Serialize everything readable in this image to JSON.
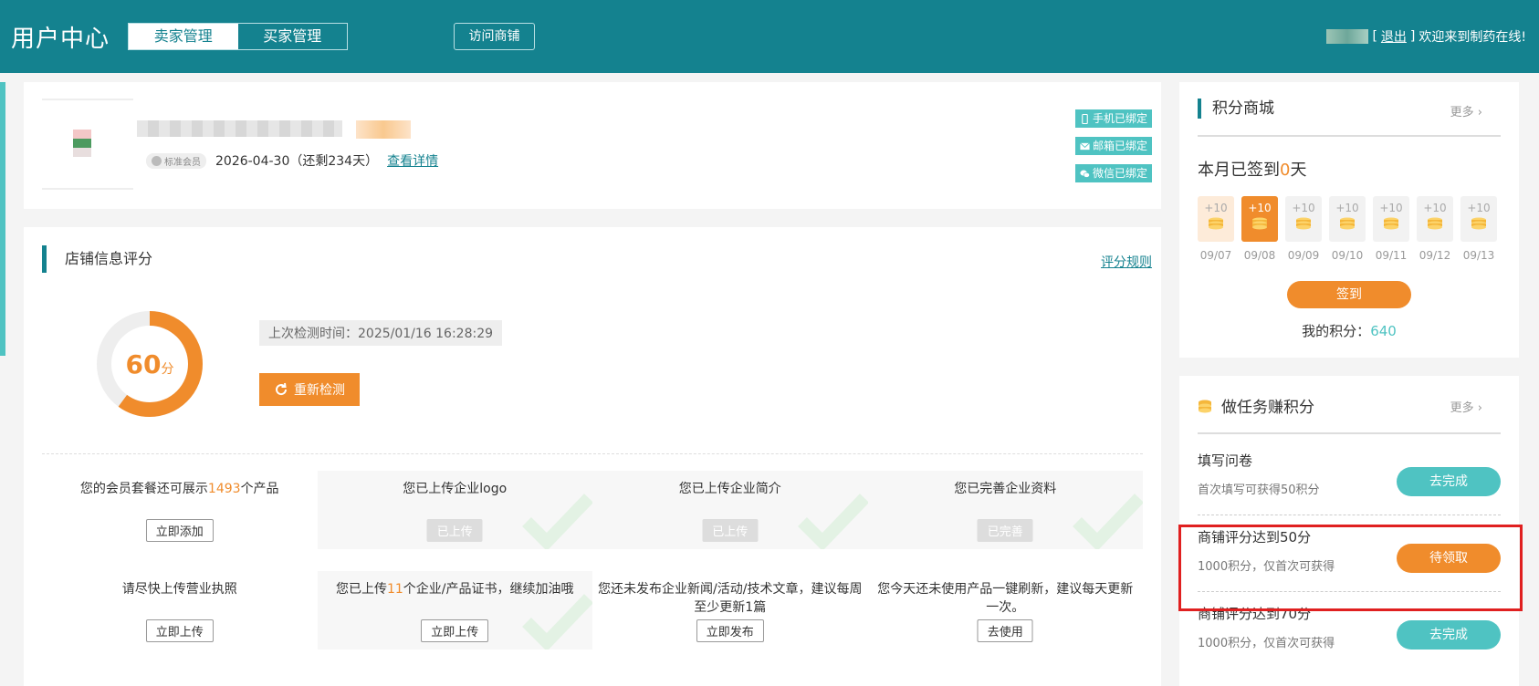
{
  "header": {
    "title": "用户中心",
    "tabs": [
      "卖家管理",
      "买家管理"
    ],
    "visit_shop": "访问商铺",
    "logout_open": "[",
    "logout": "退出",
    "logout_close": "]",
    "welcome": "欢迎来到制药在线!"
  },
  "profile": {
    "member_level": "标准会员",
    "expiry": "2026-04-30（还剩234天）",
    "detail_link": "查看详情",
    "bindings": [
      "手机已绑定",
      "邮箱已绑定",
      "微信已绑定"
    ]
  },
  "score": {
    "title": "店铺信息评分",
    "rules_link": "评分规则",
    "value": "60",
    "unit": "分",
    "percent": 60,
    "last_check": "上次检测时间：2025/01/16 16:28:29",
    "recheck": "重新检测",
    "cells": [
      {
        "pre": "您的会员套餐还可展示",
        "hl": "1493",
        "post": "个产品",
        "btn": "立即添加",
        "done": false
      },
      {
        "pre": "您已上传企业logo",
        "hl": "",
        "post": "",
        "btn": "已上传",
        "done": true
      },
      {
        "pre": "您已上传企业简介",
        "hl": "",
        "post": "",
        "btn": "已上传",
        "done": true
      },
      {
        "pre": "您已完善企业资料",
        "hl": "",
        "post": "",
        "btn": "已完善",
        "done": true
      },
      {
        "pre": "请尽快上传营业执照",
        "hl": "",
        "post": "",
        "btn": "立即上传",
        "done": false
      },
      {
        "pre": "您已上传",
        "hl": "11",
        "post": "个企业/产品证书，继续加油哦",
        "btn": "立即上传",
        "done": true
      },
      {
        "pre": "您还未发布企业新闻/活动/技术文章，建议每周至少更新1篇",
        "hl": "",
        "post": "",
        "btn": "立即发布",
        "done": false
      },
      {
        "pre": "您今天还未使用产品一键刷新，建议每天更新一次。",
        "hl": "",
        "post": "",
        "btn": "去使用",
        "done": false
      }
    ]
  },
  "mall": {
    "title": "积分商城",
    "more": "更多",
    "signed_pre": "本月已签到",
    "signed_count": "0",
    "signed_post": "天",
    "days": [
      {
        "bonus": "+10",
        "date": "09/07",
        "state": "first"
      },
      {
        "bonus": "+10",
        "date": "09/08",
        "state": "active"
      },
      {
        "bonus": "+10",
        "date": "09/09",
        "state": ""
      },
      {
        "bonus": "+10",
        "date": "09/10",
        "state": ""
      },
      {
        "bonus": "+10",
        "date": "09/11",
        "state": ""
      },
      {
        "bonus": "+10",
        "date": "09/12",
        "state": ""
      },
      {
        "bonus": "+10",
        "date": "09/13",
        "state": ""
      }
    ],
    "sign_btn": "签到",
    "my_points_label": "我的积分：",
    "my_points": "640"
  },
  "tasks": {
    "title": "做任务赚积分",
    "more": "更多",
    "items": [
      {
        "name": "填写问卷",
        "desc": "首次填写可获得50积分",
        "btn": "去完成",
        "color": "teal"
      },
      {
        "name": "商铺评分达到50分",
        "desc": "1000积分，仅首次可获得",
        "btn": "待领取",
        "color": "orange"
      },
      {
        "name": "商铺评分达到70分",
        "desc": "1000积分，仅首次可获得",
        "btn": "去完成",
        "color": "teal"
      }
    ]
  },
  "colors": {
    "header": "#14828f",
    "accent": "#f08c2c",
    "teal": "#4fc3c2"
  }
}
